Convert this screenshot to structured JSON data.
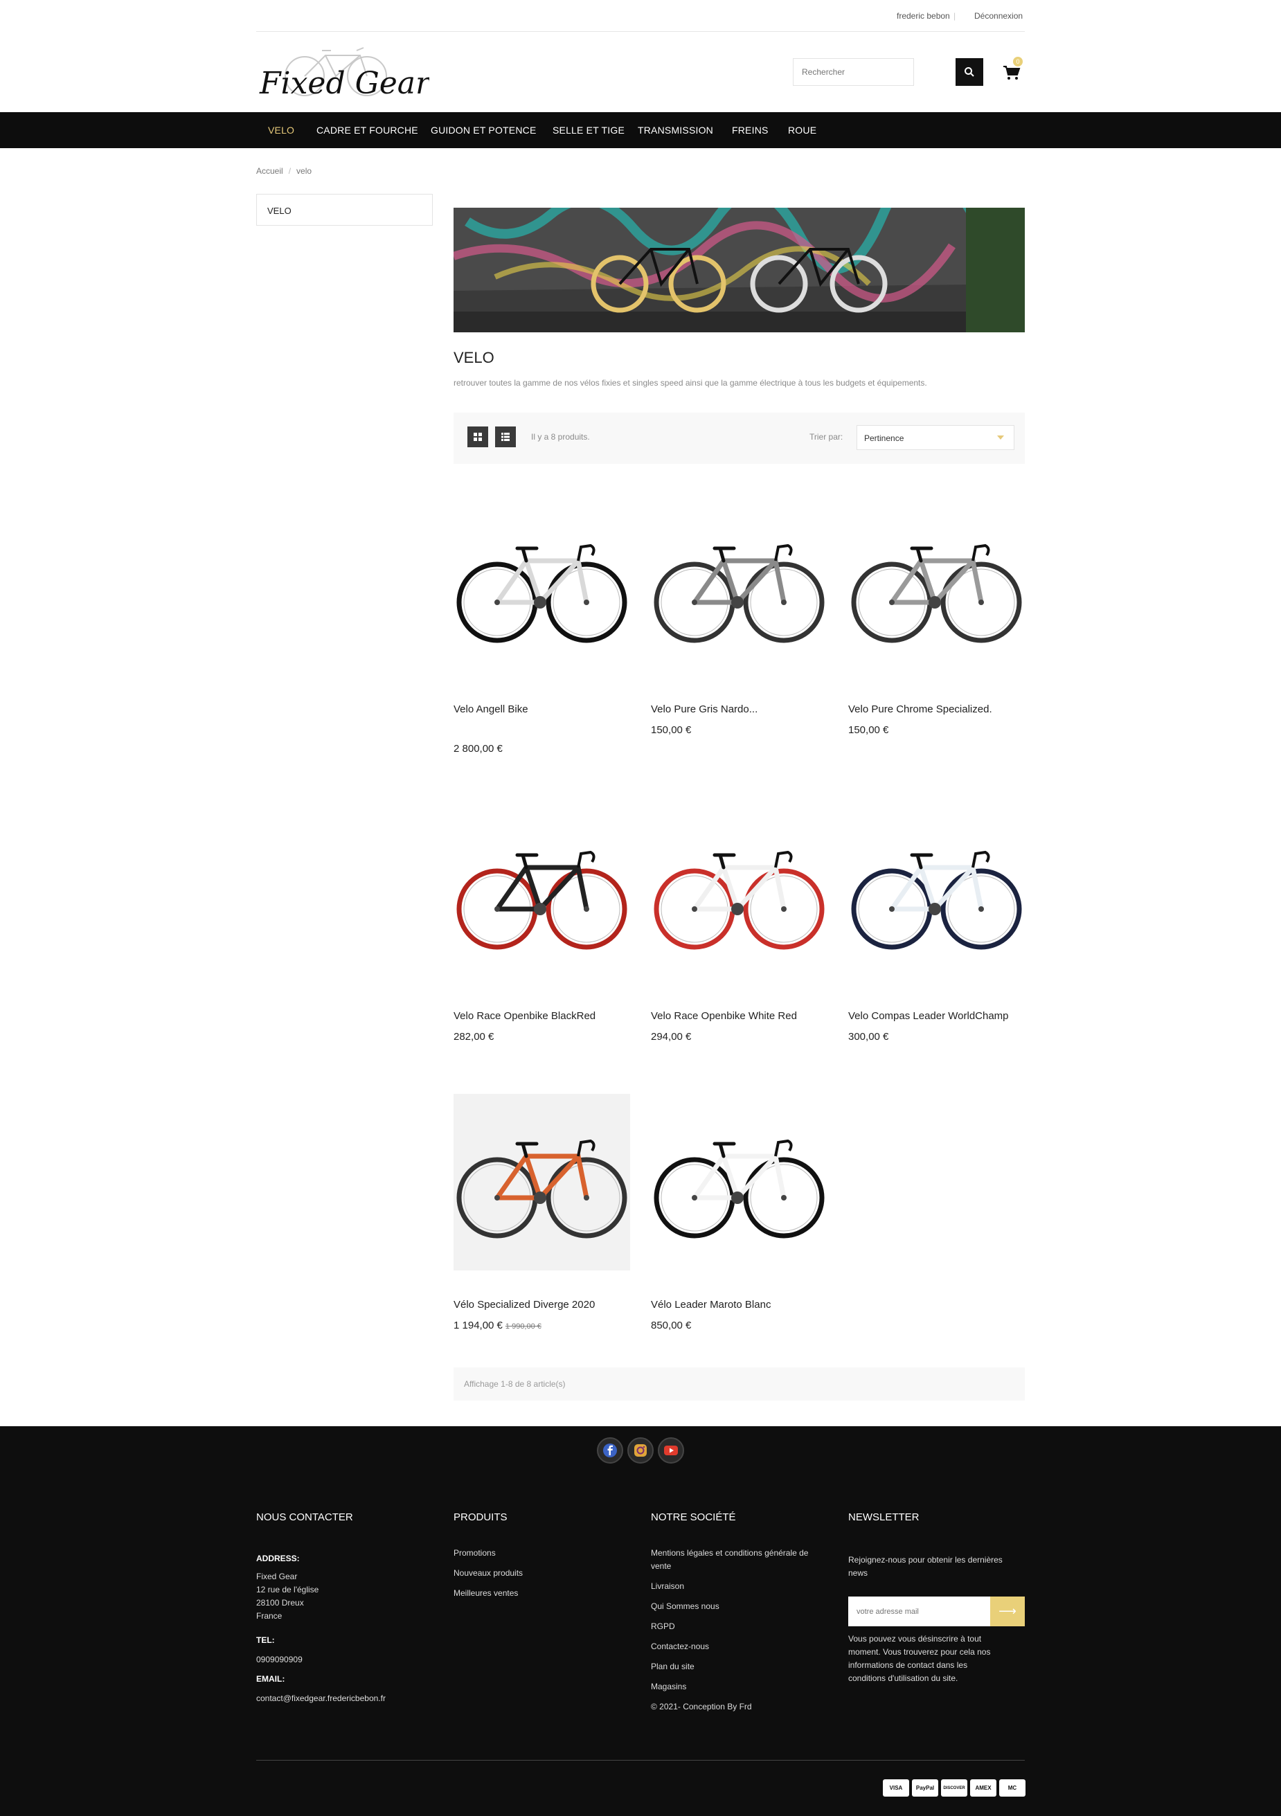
{
  "user": {
    "name": "frederic bebon",
    "logout": "Déconnexion"
  },
  "header": {
    "logo_text": "Fixed Gear",
    "search_placeholder": "Rechercher",
    "cart_count": "0"
  },
  "nav": [
    "VELO",
    "CADRE ET FOURCHE",
    "GUIDON ET POTENCE",
    "SELLE ET TIGE",
    "TRANSMISSION",
    "FREINS",
    "ROUE"
  ],
  "breadcrumb": [
    "Accueil",
    "velo"
  ],
  "sidebar": {
    "category": "VELO"
  },
  "category": {
    "title": "VELO",
    "description": "retrouver toutes la gamme de nos vélos fixies et singles speed ainsi que la gamme électrique à tous les budgets et équipements."
  },
  "sort": {
    "count_text": "Il y a 8 produits.",
    "label": "Trier par:",
    "selected": "Pertinence"
  },
  "products": [
    {
      "name": "Velo Angell Bike",
      "price": "2 800,00 €",
      "old_price": "",
      "frame": "#d9d9d9",
      "wheel": "#111111"
    },
    {
      "name": "Velo Pure Gris Nardo...",
      "price": "150,00 €",
      "old_price": "",
      "frame": "#8a8a8a",
      "wheel": "#333333"
    },
    {
      "name": "Velo Pure Chrome Specialized.",
      "price": "150,00 €",
      "old_price": "",
      "frame": "#9a9a9a",
      "wheel": "#333333"
    },
    {
      "name": "Velo Race Openbike BlackRed",
      "price": "282,00 €",
      "old_price": "",
      "frame": "#222222",
      "wheel": "#b3241c"
    },
    {
      "name": "Velo Race Openbike White Red",
      "price": "294,00 €",
      "old_price": "",
      "frame": "#f0f0f0",
      "wheel": "#c9302a"
    },
    {
      "name": "Velo Compas Leader WorldChamp",
      "price": "300,00 €",
      "old_price": "",
      "frame": "#e8eef3",
      "wheel": "#1b2340"
    },
    {
      "name": "Vélo Specialized Diverge 2020",
      "price": "1 194,00 €",
      "old_price": "1 990,00 €",
      "frame": "#d8622e",
      "wheel": "#333333"
    },
    {
      "name": "Vélo Leader Maroto Blanc",
      "price": "850,00 €",
      "old_price": "",
      "frame": "#f3f3f3",
      "wheel": "#111111"
    }
  ],
  "pagination": {
    "text": "Affichage 1-8 de 8 article(s)"
  },
  "footer": {
    "contact": {
      "title": "NOUS CONTACTER",
      "address_label": "ADDRESS:",
      "address": [
        "Fixed Gear",
        "12 rue de l'église",
        "28100 Dreux",
        "France"
      ],
      "tel_label": "TEL:",
      "tel": "0909090909",
      "email_label": "EMAIL:",
      "email": "contact@fixedgear.fredericbebon.fr"
    },
    "products": {
      "title": "PRODUITS",
      "links": [
        "Promotions",
        "Nouveaux produits",
        "Meilleures ventes"
      ]
    },
    "company": {
      "title": "NOTRE SOCIÉTÉ",
      "links": [
        "Mentions légales et conditions générale de",
        "vente",
        "Livraison",
        "Qui Sommes nous",
        "RGPD",
        "Contactez-nous",
        "Plan du site",
        "Magasins",
        "© 2021- Conception By Frd"
      ]
    },
    "newsletter": {
      "title": "NEWSLETTER",
      "intro": [
        "Rejoignez-nous pour obtenir les dernières",
        "news"
      ],
      "placeholder": "votre adresse mail",
      "note": [
        "Vous pouvez vous désinscrire à tout",
        "moment. Vous trouverez pour cela nos",
        "informations de contact dans les",
        "conditions d'utilisation du site."
      ]
    },
    "payments": [
      "VISA",
      "PayPal",
      "DISCOVER",
      "AMEX",
      "MC"
    ]
  },
  "colors": {
    "accent": "#e6c97a",
    "nav_bg": "#0d0d0d",
    "footer_bg": "#0e0e0e"
  }
}
